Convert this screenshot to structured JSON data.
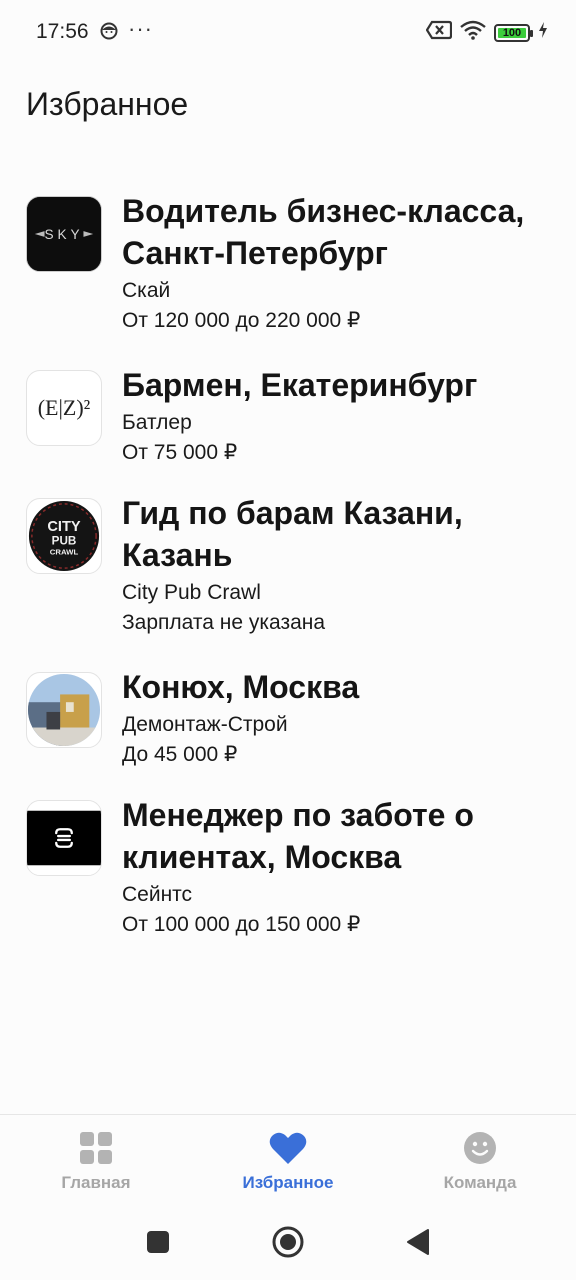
{
  "status_bar": {
    "time": "17:56",
    "more": "···",
    "battery": "100",
    "icons": [
      "face-icon",
      "sim-off-icon",
      "wifi-icon",
      "battery-icon",
      "charging-icon"
    ]
  },
  "page": {
    "title": "Избранное"
  },
  "jobs": [
    {
      "title": "Водитель бизнес-класса, Санкт-Петербург",
      "company": "Скай",
      "salary": "От 120 000 до 220 000 ₽",
      "logo_text": "SKY"
    },
    {
      "title": "Бармен, Екатеринбург",
      "company": "Батлер",
      "salary": "От 75 000 ₽",
      "logo_text": "(E|Z)²"
    },
    {
      "title": "Гид по барам Казани, Казань",
      "company": "City Pub Crawl",
      "salary": "Зарплата не указана",
      "logo_text": "CITY PUB CRAWL"
    },
    {
      "title": "Конюх, Москва",
      "company": "Демонтаж-Строй",
      "salary": "До 45 000 ₽",
      "logo_text": ""
    },
    {
      "title": "Менеджер по заботе о клиентах, Москва",
      "company": "Сейнтс",
      "salary": "От 100 000 до 150 000 ₽",
      "logo_text": ""
    }
  ],
  "bottom_nav": [
    {
      "label": "Главная",
      "icon": "grid-icon",
      "active": false
    },
    {
      "label": "Избранное",
      "icon": "heart-icon",
      "active": true
    },
    {
      "label": "Команда",
      "icon": "smiley-icon",
      "active": false
    }
  ],
  "colors": {
    "accent": "#3a6fd8",
    "inactive": "#a6a6a6",
    "background": "#fcfcfc"
  }
}
